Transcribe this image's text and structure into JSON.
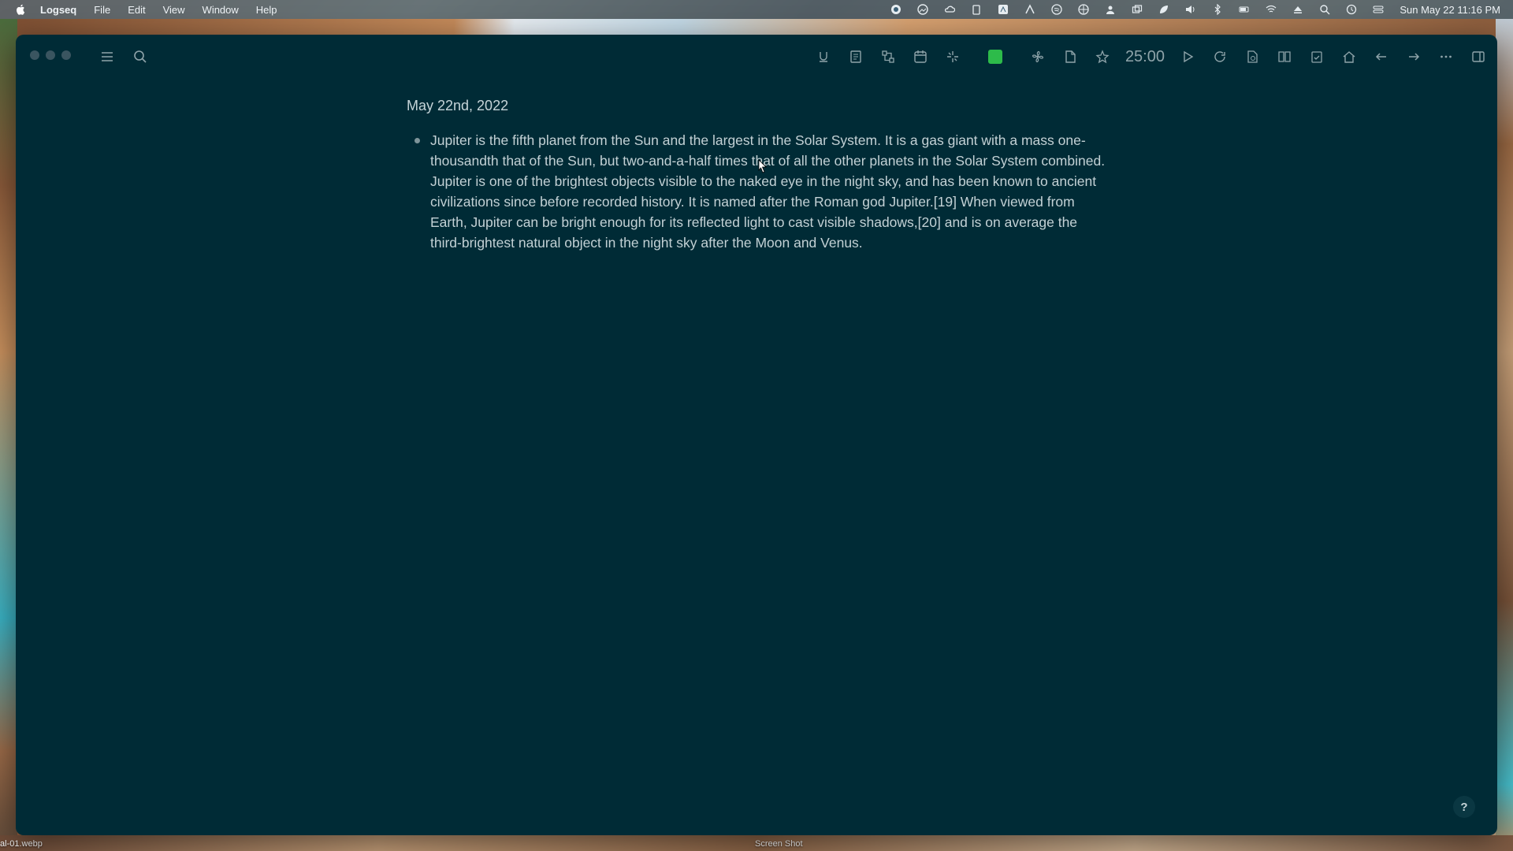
{
  "menubar": {
    "app_name": "Logseq",
    "menus": [
      "File",
      "Edit",
      "View",
      "Window",
      "Help"
    ],
    "status_icons": [
      "record-icon",
      "photos-icon",
      "cloud-icon",
      "clipboard-icon",
      "appstore-icon",
      "adobe-icon",
      "spotify-icon",
      "vpn-icon",
      "user-icon",
      "windows-icon",
      "leaf-icon",
      "volume-icon",
      "bluetooth-icon",
      "battery-icon",
      "wifi-icon",
      "eject-icon",
      "spotlight-icon",
      "time-machine-icon",
      "control-center-icon"
    ],
    "clock": "Sun May 22  11:16 PM"
  },
  "toolbar": {
    "left": [
      "sidebar-toggle-icon",
      "search-icon"
    ],
    "right": [
      "underline-icon",
      "book-icon",
      "graph-icon",
      "calendar-icon",
      "sparkle-icon",
      "pomodoro-block",
      "fan-icon",
      "document-icon",
      "star-icon",
      "play-icon",
      "refresh-icon",
      "file-search-icon",
      "book-open-icon",
      "clipboard-check-icon",
      "home-icon",
      "arrow-left-icon",
      "arrow-right-icon",
      "more-icon",
      "right-sidebar-icon"
    ],
    "timer": "25:00",
    "pomodoro_color": "#2dbb4a"
  },
  "page": {
    "title": "May 22nd, 2022",
    "blocks": [
      {
        "text": "Jupiter is the fifth planet from the Sun and the largest in the Solar System. It is a gas giant with a mass one-thousandth that of the Sun, but two-and-a-half times that of all the other planets in the Solar System combined. Jupiter is one of the brightest objects visible to the naked eye in the night sky, and has been known to ancient civilizations since before recorded history. It is named after the Roman god Jupiter.[19] When viewed from Earth, Jupiter can be bright enough for its reflected light to cast visible shadows,[20] and is on average the third-brightest natural object in the night sky after the Moon and Venus."
      }
    ]
  },
  "help_button": "?",
  "desktop": {
    "labels": [
      "al-01.webp",
      "Screen Shot"
    ]
  },
  "colors": {
    "background": "#002b36",
    "text": "#c3d1d5",
    "icon": "#8fa4aa"
  }
}
